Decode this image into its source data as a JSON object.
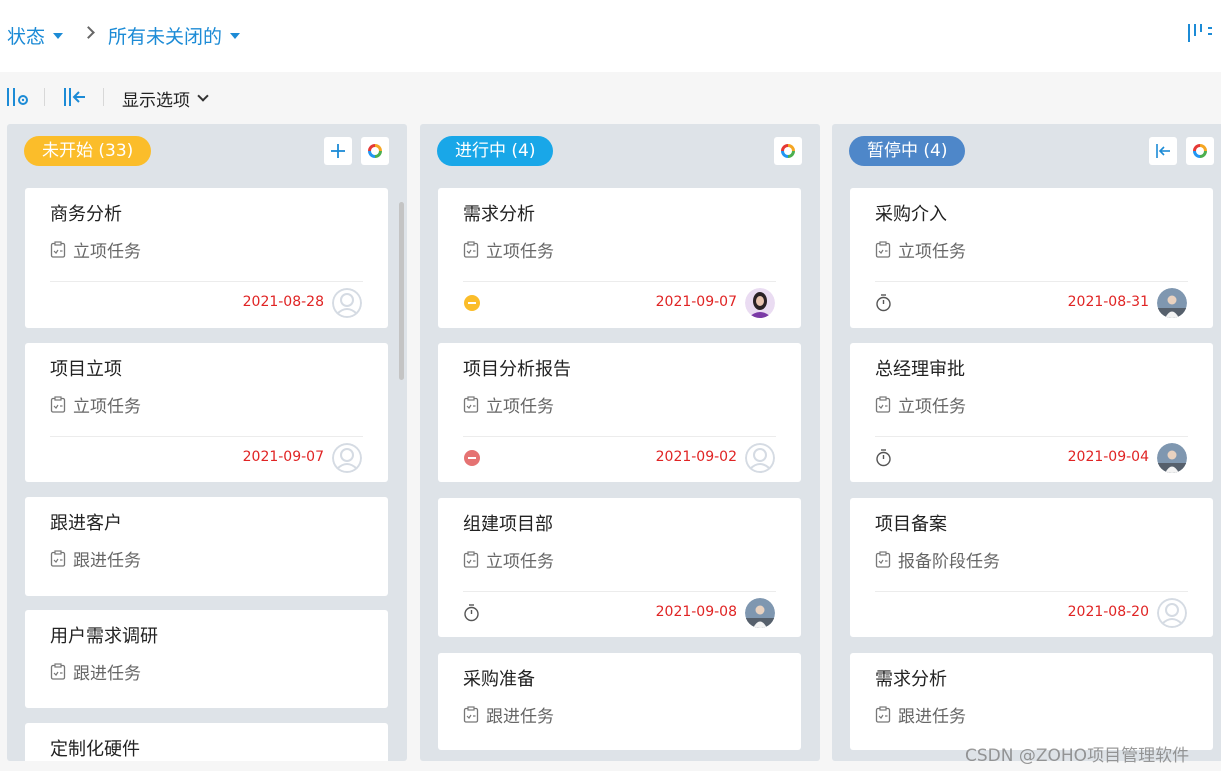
{
  "breadcrumb": {
    "status_label": "状态",
    "filter_label": "所有未关闭的"
  },
  "toolbar": {
    "display_options_label": "显示选项"
  },
  "columns": [
    {
      "title": "未开始 (33)",
      "color": "#fbbd2a",
      "cards": [
        {
          "title": "商务分析",
          "type": "立项任务",
          "date": "2021-08-28",
          "avatar": "placeholder"
        },
        {
          "title": "项目立项",
          "type": "立项任务",
          "date": "2021-09-07",
          "avatar": "placeholder"
        },
        {
          "title": "跟进客户",
          "type": "跟进任务"
        },
        {
          "title": "用户需求调研",
          "type": "跟进任务"
        },
        {
          "title": "定制化硬件"
        }
      ]
    },
    {
      "title": "进行中 (4)",
      "color": "#19a7e8",
      "cards": [
        {
          "title": "需求分析",
          "type": "立项任务",
          "date": "2021-09-07",
          "status": "yellow-minus",
          "avatar": "woman-photo"
        },
        {
          "title": "项目分析报告",
          "type": "立项任务",
          "date": "2021-09-02",
          "status": "red-minus",
          "avatar": "placeholder"
        },
        {
          "title": "组建项目部",
          "type": "立项任务",
          "date": "2021-09-08",
          "status": "timer",
          "avatar": "man-photo"
        },
        {
          "title": "采购准备",
          "type": "跟进任务"
        }
      ]
    },
    {
      "title": "暂停中 (4)",
      "color": "#4e87c9",
      "cards": [
        {
          "title": "采购介入",
          "type": "立项任务",
          "date": "2021-08-31",
          "status": "timer",
          "avatar": "man-photo"
        },
        {
          "title": "总经理审批",
          "type": "立项任务",
          "date": "2021-09-04",
          "status": "timer",
          "avatar": "man-photo"
        },
        {
          "title": "项目备案",
          "type": "报备阶段任务",
          "date": "2021-08-20",
          "avatar": "placeholder"
        },
        {
          "title": "需求分析",
          "type": "跟进任务"
        }
      ]
    }
  ],
  "watermark": "CSDN @ZOHO项目管理软件",
  "colors": {
    "accent_blue": "#1c8bd6",
    "date_red": "#e02424",
    "status_yellow": "#fbbd2a",
    "status_red": "#e57373"
  }
}
